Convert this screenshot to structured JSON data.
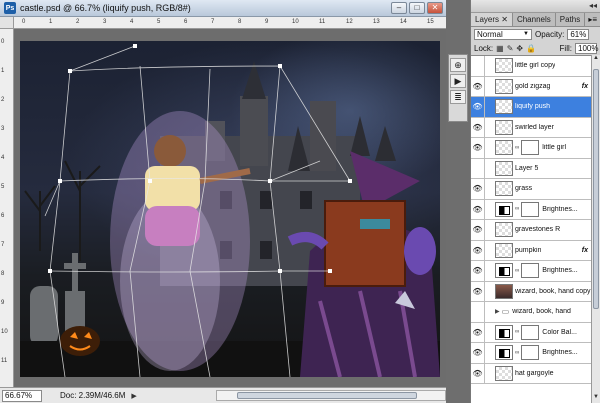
{
  "document": {
    "title": "castle.psd @ 66.7% (liquify push, RGB/8#)",
    "app_icon": "Ps",
    "window_buttons": {
      "minimize": "–",
      "maximize": "□",
      "close": "✕"
    },
    "ruler_top": [
      "0",
      "1",
      "2",
      "3",
      "4",
      "5",
      "6",
      "7",
      "8",
      "9",
      "10",
      "11",
      "12",
      "13",
      "14",
      "15"
    ],
    "ruler_left": [
      "0",
      "1",
      "2",
      "3",
      "4",
      "5",
      "6",
      "7",
      "8",
      "9",
      "10",
      "11"
    ],
    "zoom": "66.67%",
    "doc_info": "Doc: 2.39M/46.6M",
    "status_arrow": "▶"
  },
  "tool_strip": [
    "⊕",
    "▶",
    "≣"
  ],
  "layers_panel": {
    "tabs": [
      "Layers ✕",
      "Channels",
      "Paths"
    ],
    "menu_icon": "▸≡",
    "collapse_icon": "◂◂",
    "blend_mode": "Normal",
    "opacity_label": "Opacity:",
    "opacity_value": "61%",
    "lock_label": "Lock:",
    "fill_label": "Fill:",
    "fill_value": "100%",
    "layers": [
      {
        "name": "little girl copy",
        "visible": false,
        "kind": "pixel"
      },
      {
        "name": "gold zigzag",
        "visible": true,
        "kind": "pixel",
        "fx": "fx"
      },
      {
        "name": "liquify push",
        "visible": true,
        "kind": "pixel",
        "selected": true
      },
      {
        "name": "swirled layer",
        "visible": true,
        "kind": "pixel"
      },
      {
        "name": "little girl",
        "visible": true,
        "kind": "masked"
      },
      {
        "name": "Layer 5",
        "visible": false,
        "kind": "pixel"
      },
      {
        "name": "grass",
        "visible": true,
        "kind": "pixel"
      },
      {
        "name": "Brightnes...",
        "visible": true,
        "kind": "adjustment"
      },
      {
        "name": "gravestones R",
        "visible": true,
        "kind": "pixel"
      },
      {
        "name": "pumpkin",
        "visible": true,
        "kind": "pixel",
        "fx": "fx"
      },
      {
        "name": "Brightnes...",
        "visible": true,
        "kind": "adjustment"
      },
      {
        "name": "wizard, book, hand copy",
        "visible": true,
        "kind": "photo"
      },
      {
        "name": "wizard, book, hand",
        "visible": false,
        "kind": "group"
      },
      {
        "name": "Color Bal...",
        "visible": true,
        "kind": "adjustment"
      },
      {
        "name": "Brightnes...",
        "visible": true,
        "kind": "adjustment"
      },
      {
        "name": "hat gargoyle",
        "visible": true,
        "kind": "pixel"
      }
    ]
  },
  "colors": {
    "selection_blue": "#3d80df",
    "panel_gray": "#d4d4d4"
  }
}
